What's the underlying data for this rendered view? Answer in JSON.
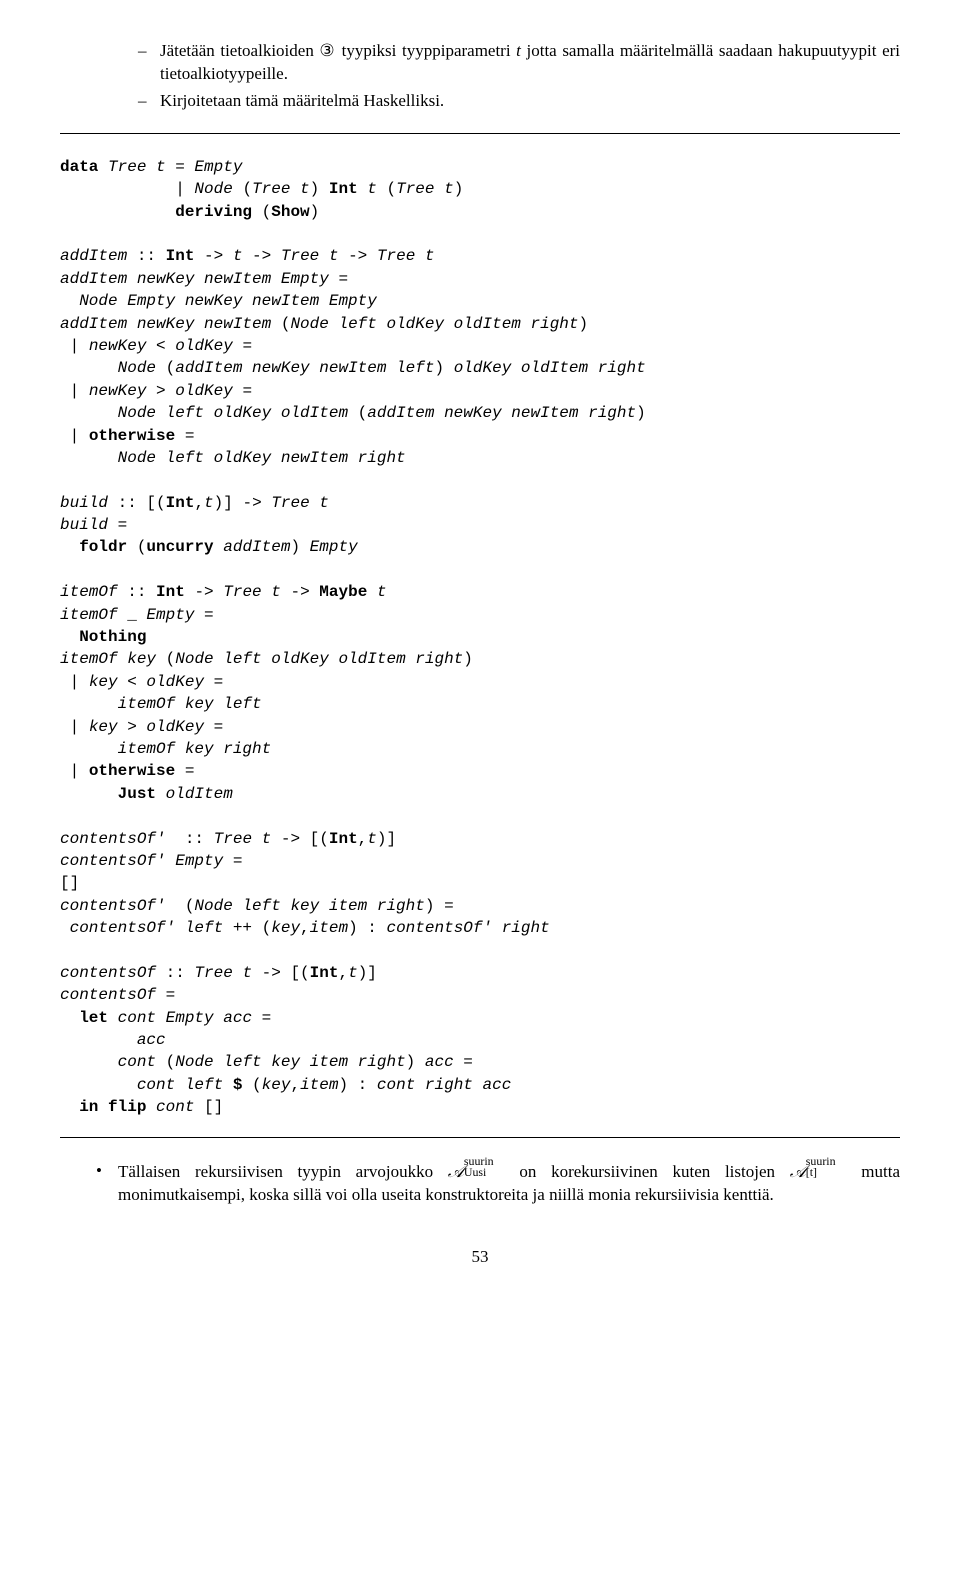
{
  "intro": {
    "item1_a": "Jätetään tietoalkioiden ",
    "item1_circled": "③",
    "item1_b": " tyypiksi tyyppiparametri ",
    "item1_t": "t",
    "item1_c": " jotta samalla määritelmällä saadaan hakupuutyypit eri tietoalkiotyypeille.",
    "item2": "Kirjoitetaan tämä määritelmä Haskelliksi."
  },
  "code": {
    "l01a": "data",
    "l01b": " Tree t ",
    "l01c": "=",
    "l01d": " Empty",
    "l02a": "            | ",
    "l02b": "Node ",
    "l02c": "(",
    "l02d": "Tree t",
    "l02e": ") ",
    "l02f": "Int",
    "l02g": " t ",
    "l02h": "(",
    "l02i": "Tree t",
    "l02j": ")",
    "l03a": "            ",
    "l03b": "deriving",
    "l03c": " (",
    "l03d": "Show",
    "l03e": ")",
    "blank1": " ",
    "l05a": "addItem ",
    "l05b": "::",
    "l05c": " ",
    "l05d": "Int",
    "l05e": " -> ",
    "l05f": "t ",
    "l05g": "-> ",
    "l05h": "Tree t ",
    "l05i": "-> ",
    "l05j": "Tree t",
    "l06a": "addItem newKey newItem Empty ",
    "l06b": "=",
    "l07": "  Node Empty newKey newItem Empty",
    "l08a": "addItem newKey newItem ",
    "l08b": "(",
    "l08c": "Node left oldKey oldItem right",
    "l08d": ")",
    "l09a": " | ",
    "l09b": "newKey ",
    "l09c": "<",
    "l09d": " oldKey ",
    "l09e": "=",
    "l10a": "      Node ",
    "l10b": "(",
    "l10c": "addItem newKey newItem left",
    "l10d": ")",
    "l10e": " oldKey oldItem right",
    "l11a": " | ",
    "l11b": "newKey ",
    "l11c": ">",
    "l11d": " oldKey ",
    "l11e": "=",
    "l12a": "      Node left oldKey oldItem ",
    "l12b": "(",
    "l12c": "addItem newKey newItem right",
    "l12d": ")",
    "l13a": " | ",
    "l13b": "otherwise",
    "l13c": " =",
    "l14": "      Node left oldKey newItem right",
    "blank2": " ",
    "l16a": "build ",
    "l16b": "::",
    "l16c": " [(",
    "l16d": "Int",
    "l16e": ",",
    "l16f": "t",
    "l16g": ")] -> ",
    "l16h": "Tree t",
    "l17a": "build ",
    "l17b": "=",
    "l18a": "  ",
    "l18b": "foldr",
    "l18c": " (",
    "l18d": "uncurry",
    "l18e": " addItem",
    "l18f": ")",
    "l18g": " Empty",
    "blank3": " ",
    "l20a": "itemOf ",
    "l20b": "::",
    "l20c": " ",
    "l20d": "Int",
    "l20e": " -> ",
    "l20f": "Tree t ",
    "l20g": "-> ",
    "l20h": "Maybe",
    "l20i": " t",
    "l21a": "itemOf ",
    "l21b": "_",
    "l21c": " Empty ",
    "l21d": "=",
    "l22a": "  ",
    "l22b": "Nothing",
    "l23a": "itemOf key ",
    "l23b": "(",
    "l23c": "Node left oldKey oldItem right",
    "l23d": ")",
    "l24a": " | ",
    "l24b": "key ",
    "l24c": "<",
    "l24d": " oldKey ",
    "l24e": "=",
    "l25": "      itemOf key left",
    "l26a": " | ",
    "l26b": "key ",
    "l26c": ">",
    "l26d": " oldKey ",
    "l26e": "=",
    "l27": "      itemOf key right",
    "l28a": " | ",
    "l28b": "otherwise",
    "l28c": " =",
    "l29a": "      ",
    "l29b": "Just",
    "l29c": " oldItem",
    "blank4": " ",
    "l31a": "contentsOf' ",
    "l31b": " ::",
    "l31c": " Tree t ",
    "l31d": "-> [(",
    "l31e": "Int",
    "l31f": ",",
    "l31g": "t",
    "l31h": ")]",
    "l32a": "contentsOf' Empty ",
    "l32b": "=",
    "l33": "[]",
    "l34a": "contentsOf' ",
    "l34b": " (",
    "l34c": "Node left key item right",
    "l34d": ") =",
    "l35a": " contentsOf' left ",
    "l35b": "++ (",
    "l35c": "key",
    "l35d": ",",
    "l35e": "item",
    "l35f": ") :",
    "l35g": " contentsOf' right",
    "blank5": " ",
    "l37a": "contentsOf ",
    "l37b": "::",
    "l37c": " Tree t ",
    "l37d": "-> [(",
    "l37e": "Int",
    "l37f": ",",
    "l37g": "t",
    "l37h": ")]",
    "l38a": "contentsOf ",
    "l38b": "=",
    "l39a": "  ",
    "l39b": "let",
    "l39c": " cont Empty acc ",
    "l39d": "=",
    "l40": "        acc",
    "l41a": "      cont ",
    "l41b": "(",
    "l41c": "Node left key item right",
    "l41d": ")",
    "l41e": " acc ",
    "l41f": "=",
    "l42a": "        cont left ",
    "l42b": "$",
    "l42c": " (",
    "l42d": "key",
    "l42e": ",",
    "l42f": "item",
    "l42g": ") :",
    "l42h": " cont right acc",
    "l43a": "  ",
    "l43b": "in flip",
    "l43c": " cont ",
    "l43d": "[]"
  },
  "footer": {
    "text_a": "Tällaisen rekursiivisen tyypin arvojoukko ",
    "A1": "𝒜",
    "A1_sup": "suurin",
    "A1_sub": "Uusi",
    "text_b": " on korekursiivinen kuten listojen ",
    "A2": "𝒜",
    "A2_sup": "suurin",
    "A2_sub": "[t]",
    "text_c": " mutta monimutkaisempi, koska sillä voi olla useita konstruktoreita ja niillä monia rekursiivisia kenttiä."
  },
  "page": "53"
}
